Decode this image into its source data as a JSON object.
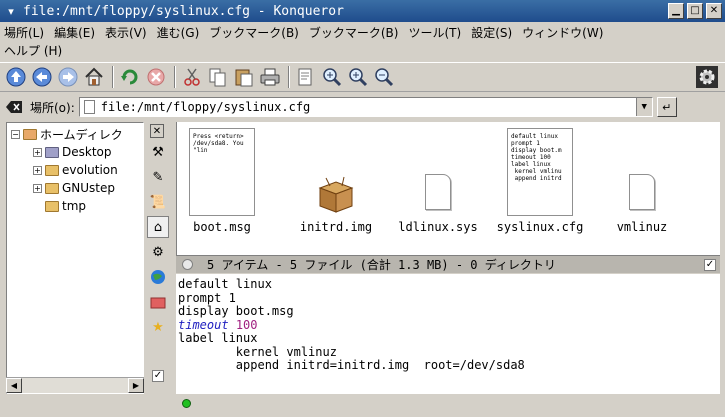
{
  "window": {
    "title": "file:/mnt/floppy/syslinux.cfg - Konqueror"
  },
  "menubar": {
    "row1": [
      "場所(L)",
      "編集(E)",
      "表示(V)",
      "進む(G)",
      "ブックマーク(B)",
      "ブックマーク(B)",
      "ツール(T)",
      "設定(S)",
      "ウィンドウ(W)"
    ],
    "row2": [
      "ヘルプ (H)"
    ]
  },
  "toolbar": {
    "icons": [
      "up-icon",
      "back-icon",
      "forward-icon",
      "home-icon",
      "reload-icon",
      "stop-icon",
      "cut-icon",
      "copy-icon",
      "paste-icon",
      "print-icon",
      "properties-icon",
      "zoom-icon",
      "zoom-in-icon",
      "zoom-out-icon",
      "kde-gear-icon"
    ]
  },
  "location": {
    "label": "場所(o):",
    "value": "file:/mnt/floppy/syslinux.cfg"
  },
  "tree": {
    "root": "ホームディレク",
    "items": [
      "Desktop",
      "evolution",
      "GNUstep",
      "tmp"
    ]
  },
  "files": [
    {
      "name": "boot.msg",
      "preview": "Press <return>\n/dev/sda8. You\n\"lin"
    },
    {
      "name": "initrd.img"
    },
    {
      "name": "ldlinux.sys"
    },
    {
      "name": "syslinux.cfg",
      "preview": "default linux\nprompt 1\ndisplay boot.m\ntimeout 100\nlabel linux\n kernel vmlinu\n append initrd"
    },
    {
      "name": "vmlinuz"
    }
  ],
  "status": {
    "text": "5 アイテム - 5 ファイル (合計 1.3 MB) - 0 ディレクトリ"
  },
  "editor": {
    "lines": [
      {
        "text": "default linux"
      },
      {
        "text": "prompt 1"
      },
      {
        "text": "display boot.msg"
      },
      {
        "keyword": "timeout",
        "number": "100"
      },
      {
        "text": "label linux"
      },
      {
        "text": "        kernel vmlinuz"
      },
      {
        "text": "        append initrd=initrd.img  root=/dev/sda8"
      }
    ]
  },
  "colors": {
    "titlebar": "#2a5a9a",
    "keyword": "#2020c0",
    "number": "#a02080",
    "led": "#20c020"
  }
}
